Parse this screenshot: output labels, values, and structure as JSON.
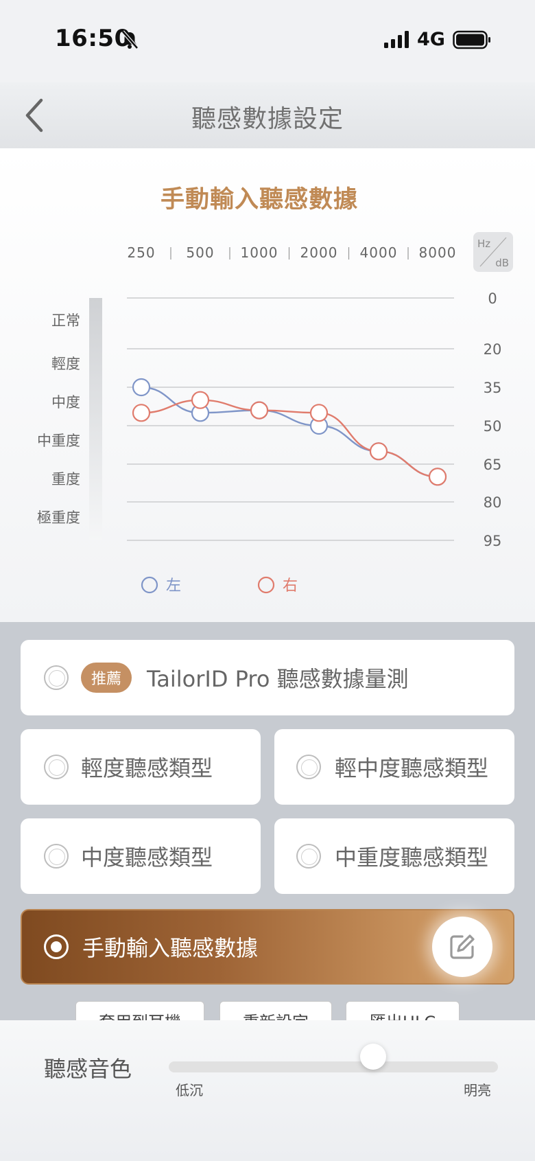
{
  "status": {
    "time": "16:50",
    "network": "4G"
  },
  "header": {
    "title": "聽感數據設定"
  },
  "chart_data": {
    "type": "line",
    "title": "手動輸入聽感數據",
    "x_unit_label": "Hz",
    "y_unit_label": "dB",
    "x": [
      "250",
      "500",
      "1000",
      "2000",
      "4000",
      "8000"
    ],
    "y_ticks": [
      0,
      20,
      35,
      50,
      65,
      80,
      95
    ],
    "ylim": [
      0,
      95
    ],
    "y_inverted": true,
    "severity_labels": [
      "正常",
      "輕度",
      "中度",
      "中重度",
      "重度",
      "極重度"
    ],
    "series": [
      {
        "name": "左",
        "color": "#7f95c8",
        "values": [
          35,
          45,
          44,
          50,
          60,
          70
        ]
      },
      {
        "name": "右",
        "color": "#e07b6c",
        "values": [
          45,
          40,
          44,
          45,
          60,
          70
        ]
      }
    ],
    "legend": "bottom"
  },
  "options": {
    "recommend_badge": "推薦",
    "tailorid": "TailorID Pro 聽感數據量測",
    "mild": "輕度聽感類型",
    "mild_moderate": "輕中度聽感類型",
    "moderate": "中度聽感類型",
    "moderate_severe": "中重度聽感類型",
    "manual": "手動輸入聽感數據"
  },
  "actions": {
    "apply": "套用到耳機",
    "reset": "重新設定",
    "export": "匯出HLC"
  },
  "tone": {
    "label": "聽感音色",
    "min_label": "低沉",
    "max_label": "明亮",
    "value_fraction": 0.62
  }
}
